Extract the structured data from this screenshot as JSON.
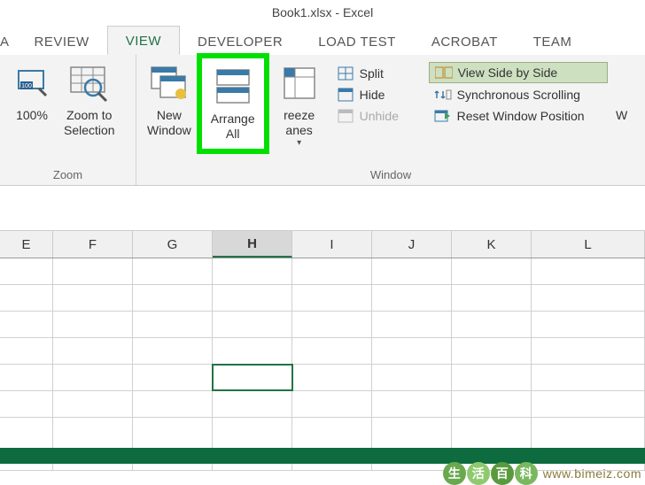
{
  "titlebar": {
    "title": "Book1.xlsx - Excel"
  },
  "tabs": {
    "items": [
      {
        "label": "A"
      },
      {
        "label": "REVIEW"
      },
      {
        "label": "VIEW",
        "active": true
      },
      {
        "label": "DEVELOPER"
      },
      {
        "label": "LOAD TEST"
      },
      {
        "label": "ACROBAT"
      },
      {
        "label": "TEAM"
      }
    ]
  },
  "ribbon": {
    "zoom": {
      "pct_label": "100%",
      "selection_label": "Zoom to\nSelection",
      "group_label": "Zoom"
    },
    "window": {
      "new_window_label": "New\nWindow",
      "arrange_all_label": "Arrange\nAll",
      "freeze_label": "reeze\nanes",
      "split_label": "Split",
      "hide_label": "Hide",
      "unhide_label": "Unhide",
      "side_by_side_label": "View Side by Side",
      "sync_scroll_label": "Synchronous Scrolling",
      "reset_pos_label": "Reset Window Position",
      "group_label": "Window",
      "partial_right": "W"
    }
  },
  "columns": [
    "E",
    "F",
    "G",
    "H",
    "I",
    "J",
    "K",
    "L"
  ],
  "selected_column": "H",
  "selected_row_index": 4,
  "watermark": {
    "chars": [
      "生",
      "活",
      "百",
      "科"
    ],
    "url": "www.bimeiz.com"
  }
}
